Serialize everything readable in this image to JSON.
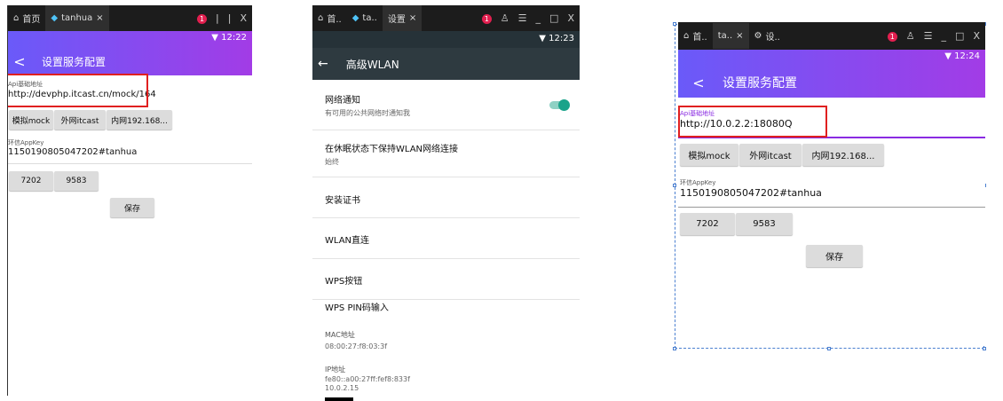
{
  "left": {
    "tabs": [
      {
        "label": "首页",
        "icon": "home-icon"
      },
      {
        "label": "tanhua",
        "icon": "flutter-icon"
      }
    ],
    "tab_close": "×",
    "window_controls": [
      "|",
      "|",
      "|",
      "X"
    ],
    "status_time": "12:22",
    "back_glyph": "<",
    "title": "设置服务配置",
    "api_label": "Api基础地址",
    "api_value": "http://devphp.itcast.cn/mock/164",
    "buttons": [
      "模拟mock",
      "外网itcast",
      "内网192.168..."
    ],
    "appkey_label": "环信AppKey",
    "appkey_value": "1150190805047202#tanhua",
    "key_buttons": [
      "7202",
      "9583"
    ],
    "save_label": "保存"
  },
  "middle": {
    "tabs": [
      {
        "label": "首..",
        "icon": "home-icon"
      },
      {
        "label": "ta..",
        "icon": "flutter-icon"
      },
      {
        "label": "设置",
        "icon": ""
      }
    ],
    "tab_close": "×",
    "status_time": "12:23",
    "back_glyph": "←",
    "title": "高级WLAN",
    "items": [
      {
        "title": "网络通知",
        "sub": "有可用的公共网络时通知我",
        "toggle": true
      },
      {
        "title": "在休眠状态下保持WLAN网络连接",
        "sub": "始终"
      },
      {
        "title": "安装证书",
        "sub": ""
      },
      {
        "title": "WLAN直连",
        "sub": ""
      },
      {
        "title": "WPS按钮",
        "sub": ""
      },
      {
        "title": "WPS PIN码输入",
        "sub": ""
      }
    ],
    "mac_label": "MAC地址",
    "mac_value": "08:00:27:f8:03:3f",
    "ip_label": "IP地址",
    "ip_value1": "fe80::a00:27ff:fef8:833f",
    "ip_value2": "10.0.2.15"
  },
  "right": {
    "tabs": [
      {
        "label": "首..",
        "icon": "home-icon"
      },
      {
        "label": "ta..",
        "icon": "flutter-icon"
      },
      {
        "label": "设..",
        "icon": "gear-icon"
      }
    ],
    "tab_close": "×",
    "status_time": "12:24",
    "back_glyph": "<",
    "title": "设置服务配置",
    "api_label": "Api基础地址",
    "api_value": "http://10.0.2.2:18080Q",
    "buttons": [
      "模拟mock",
      "外网itcast",
      "内网192.168..."
    ],
    "appkey_label": "环信AppKey",
    "appkey_value": "1150190805047202#tanhua",
    "key_buttons": [
      "7202",
      "9583"
    ],
    "save_label": "保存"
  },
  "colors": {
    "appbar_start": "#6a5af9",
    "appbar_end": "#a23ce6",
    "highlight": "#e02020",
    "toggle": "#1aa38a",
    "focused_underline": "#8a2be2"
  }
}
